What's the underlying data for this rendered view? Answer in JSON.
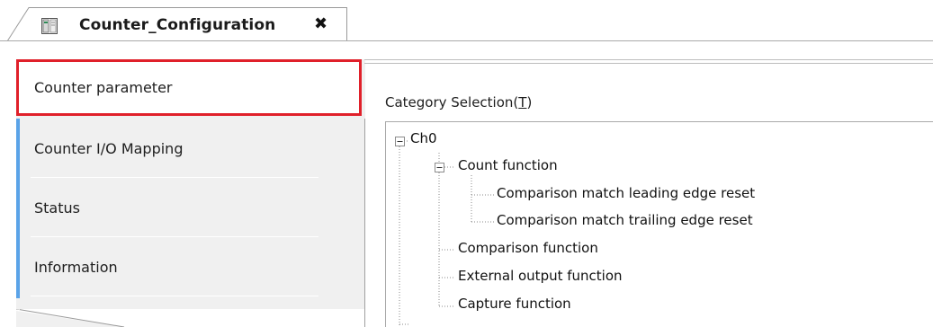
{
  "tab": {
    "title": "Counter_Configuration",
    "close_glyph": "✖",
    "icon": "module-config-icon"
  },
  "nav": {
    "items": [
      {
        "label": "Counter parameter",
        "selected": true
      },
      {
        "label": "Counter I/O Mapping",
        "selected": false
      },
      {
        "label": "Status",
        "selected": false
      },
      {
        "label": "Information",
        "selected": false
      }
    ]
  },
  "category": {
    "label_prefix": "Category Selection(",
    "label_mnemonic": "T",
    "label_suffix": ")"
  },
  "tree": {
    "root": "Ch0",
    "count_function": "Count function",
    "count_children": [
      "Comparison match leading edge reset",
      "Comparison match trailing edge reset"
    ],
    "siblings": [
      "Comparison function",
      "External output function",
      "Capture function"
    ]
  },
  "colors": {
    "selected_border": "#e0202a",
    "accent": "#5aa3e8",
    "panel_bg": "#f0f0f0"
  }
}
